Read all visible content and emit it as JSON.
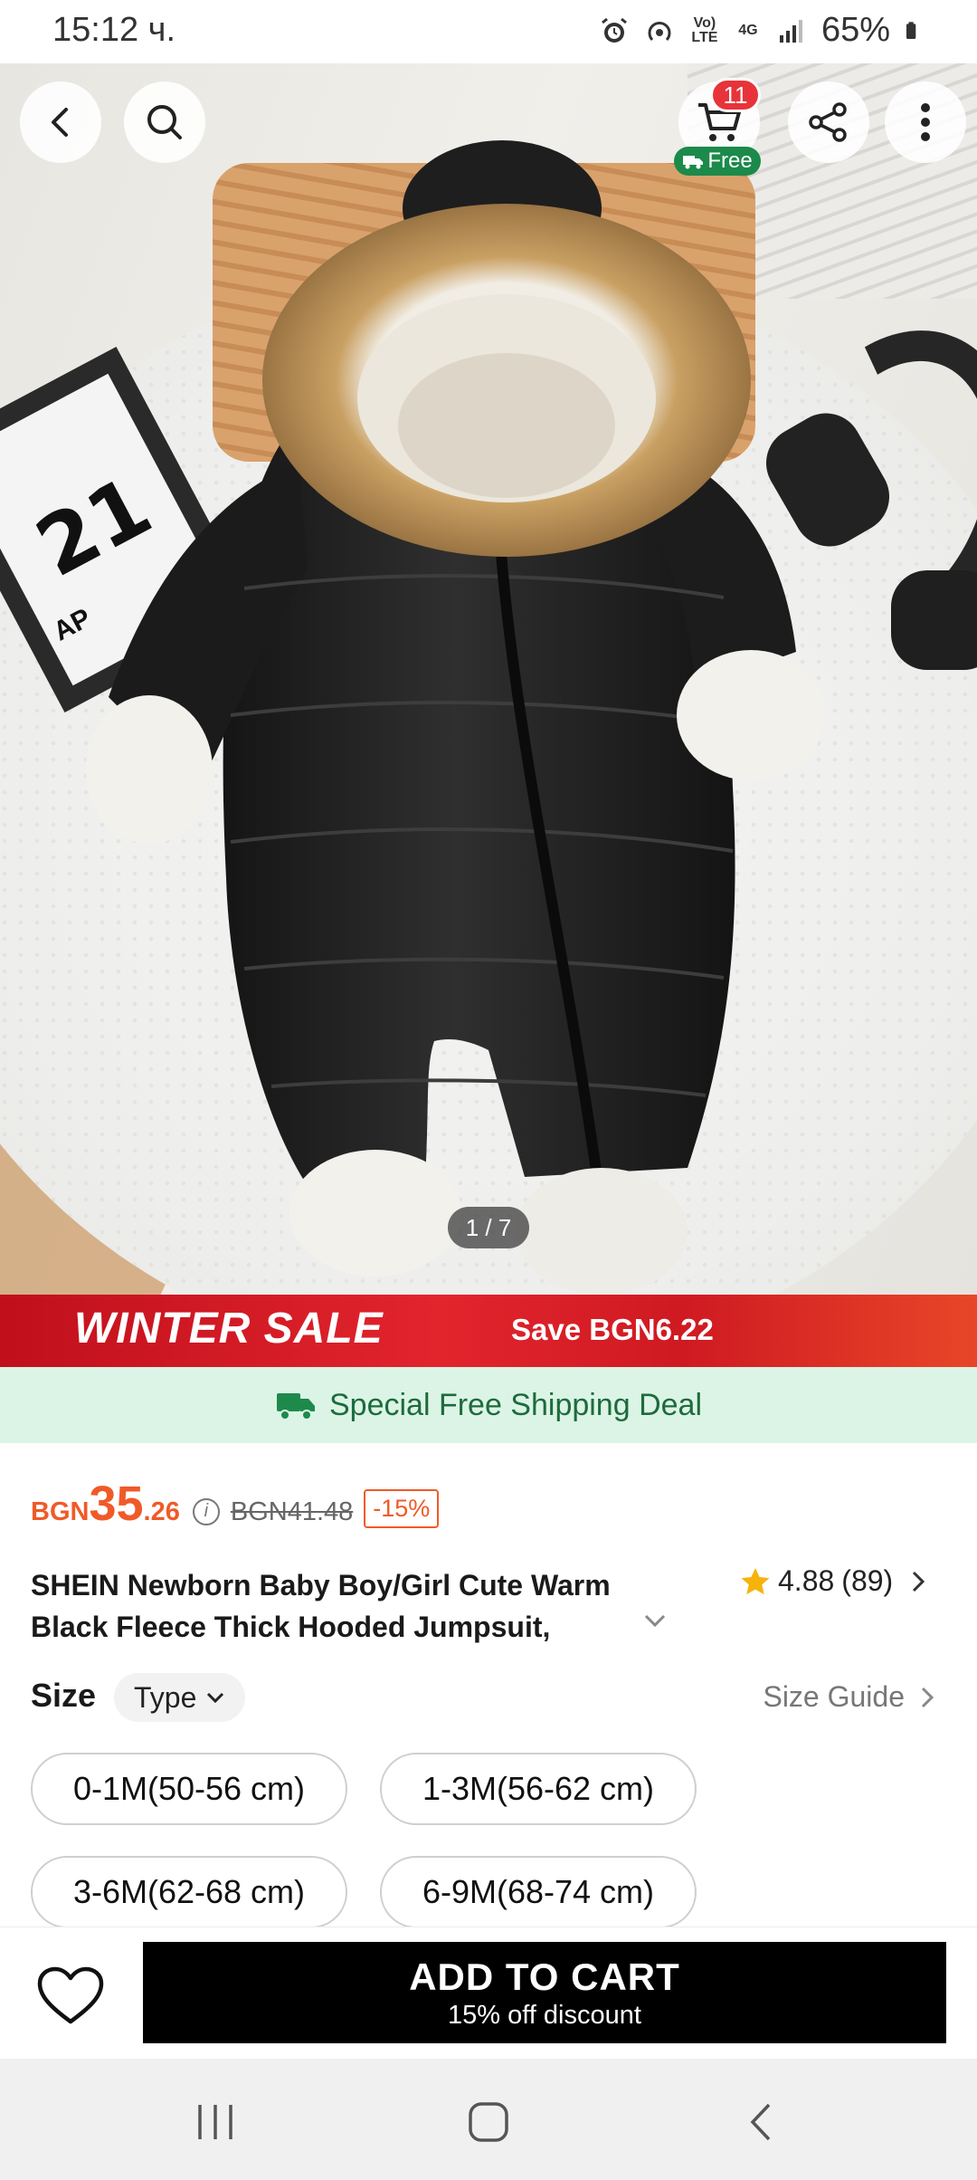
{
  "status_bar": {
    "time": "15:12 ч.",
    "volte": "Vo) LTE",
    "network": "4G",
    "battery": "65%"
  },
  "hero": {
    "cart_count": "11",
    "free_label": "Free",
    "image_counter": "1 / 7",
    "calendar_digits": "21",
    "calendar_month": "AP"
  },
  "sale_banner": {
    "title": "WINTER SALE",
    "save_text": "Save BGN6.22"
  },
  "shipping": {
    "text": "Special Free Shipping Deal",
    "color": "#1d6b3d"
  },
  "price": {
    "currency": "BGN",
    "integer": "35",
    "decimal": ".26",
    "original": "BGN41.48",
    "discount": "-15%",
    "accent_color": "#f05a28"
  },
  "product": {
    "title": "SHEIN Newborn Baby Boy/Girl Cute Warm Black Fleece Thick Hooded Jumpsuit, Suitable",
    "rating": "4.88",
    "review_count": "(89)"
  },
  "size_section": {
    "label": "Size",
    "type_dropdown": "Type",
    "size_guide": "Size Guide",
    "options": [
      "0-1M(50-56 cm)",
      "1-3M(56-62 cm)",
      "3-6M(62-68 cm)",
      "6-9M(68-74 cm)"
    ]
  },
  "action_bar": {
    "add_to_cart": "ADD TO CART",
    "discount_note": "15% off discount"
  }
}
